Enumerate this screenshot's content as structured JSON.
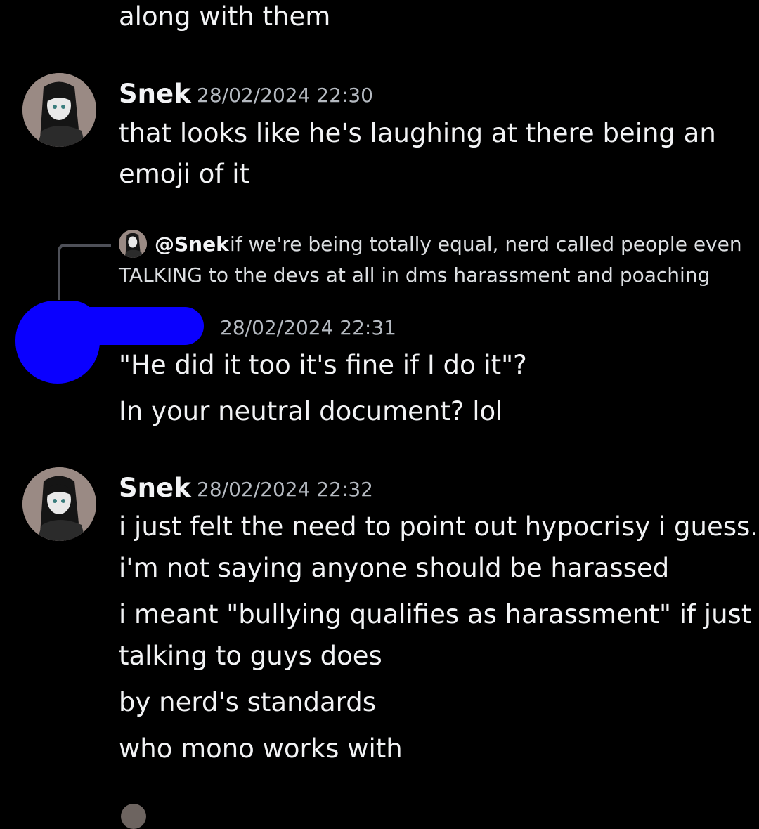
{
  "colors": {
    "background": "#000000",
    "text": "#f2f3f5",
    "muted": "#b5bac1",
    "redaction": "#0a00ff"
  },
  "top": {
    "line": "along with them"
  },
  "messages": [
    {
      "author": "Snek",
      "timestamp": "28/02/2024 22:30",
      "avatar_icon": "user-avatar-icon",
      "lines": [
        "that looks like he's laughing at there being an",
        "emoji of it"
      ]
    },
    {
      "reply": {
        "mention": "@Snek",
        "text_line1": "if we're being totally equal, nerd called people even",
        "text_line2": "TALKING to the devs at all in dms harassment and poaching"
      },
      "timestamp": "28/02/2024 22:31",
      "lines": [
        "\"He did it too it's fine if I do it\"?",
        "In your neutral document? lol"
      ]
    },
    {
      "author": "Snek",
      "timestamp": "28/02/2024 22:32",
      "avatar_icon": "user-avatar-icon",
      "lines": [
        "i just felt the need to point out hypocrisy i guess.",
        "i'm not saying anyone should be harassed",
        "i meant \"bullying qualifies as harassment\" if just",
        "talking to guys does",
        "by nerd's standards",
        "who mono works with"
      ]
    }
  ]
}
